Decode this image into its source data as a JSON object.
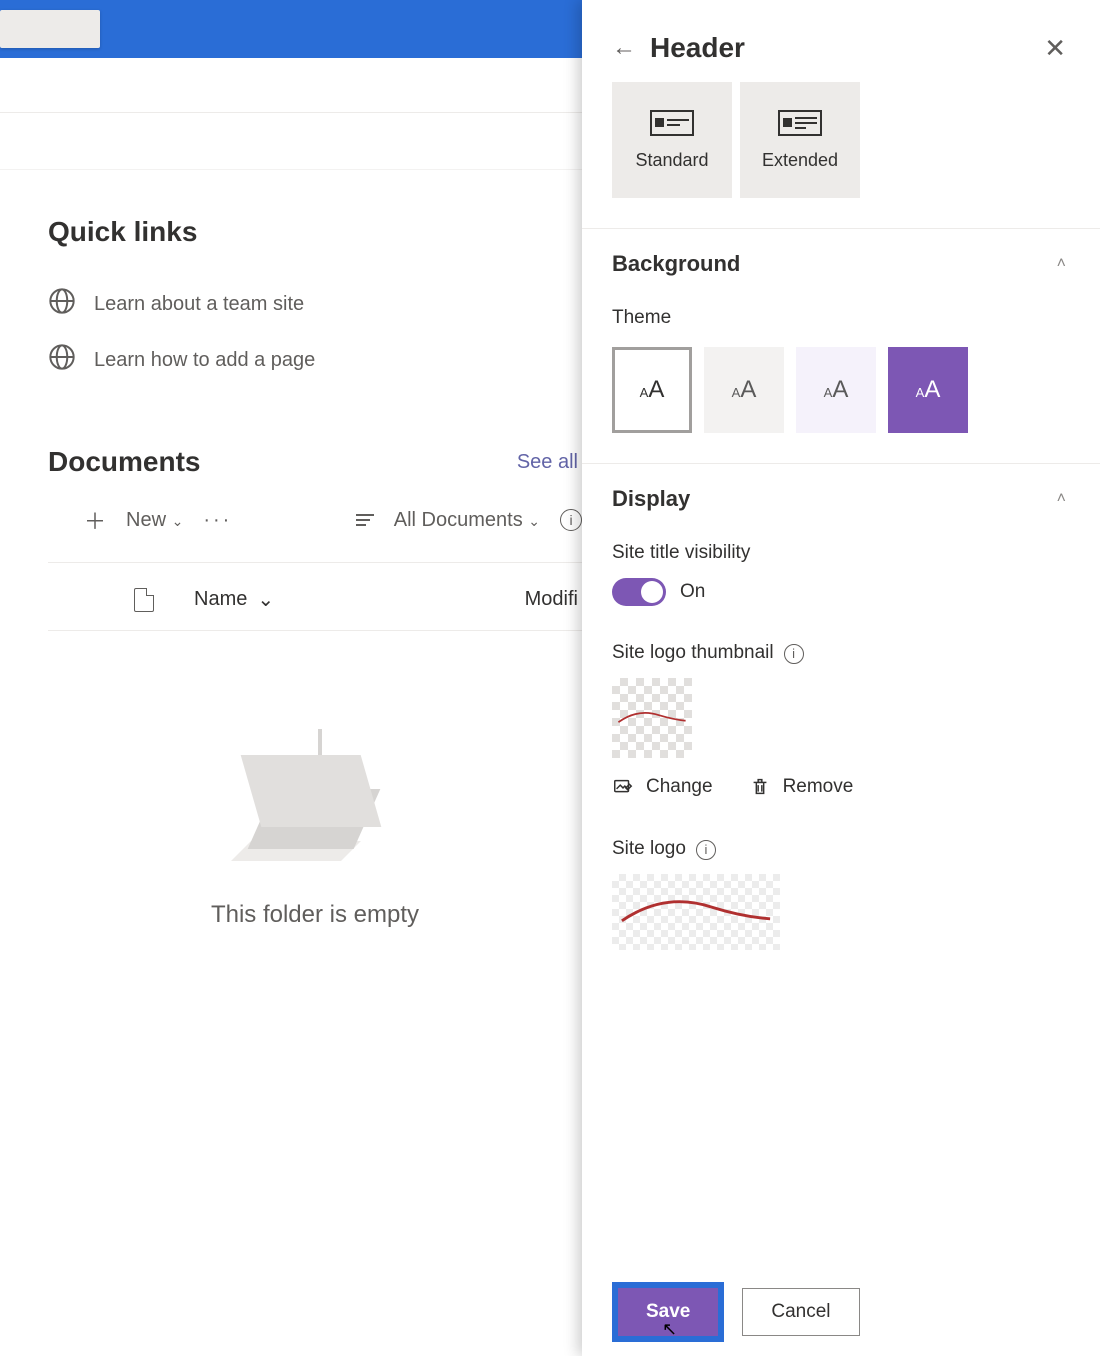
{
  "main": {
    "quick_links_title": "Quick links",
    "quick_links": [
      "Learn about a team site",
      "Learn how to add a page"
    ],
    "documents_title": "Documents",
    "see_all": "See all",
    "toolbar": {
      "new": "New",
      "view": "All Documents"
    },
    "columns": {
      "name": "Name",
      "modified": "Modifi"
    },
    "empty_text": "This folder is empty"
  },
  "panel": {
    "title": "Header",
    "layouts": [
      "Standard",
      "Extended"
    ],
    "sections": {
      "background": "Background",
      "display": "Display"
    },
    "theme_label": "Theme",
    "site_title_visibility_label": "Site title visibility",
    "toggle_state": "On",
    "site_logo_thumbnail_label": "Site logo thumbnail",
    "thumb_actions": {
      "change": "Change",
      "remove": "Remove"
    },
    "site_logo_label": "Site logo",
    "footer": {
      "save": "Save",
      "cancel": "Cancel"
    }
  },
  "colors": {
    "accent": "#7d57b4",
    "brand_bar": "#2a6dd6"
  }
}
